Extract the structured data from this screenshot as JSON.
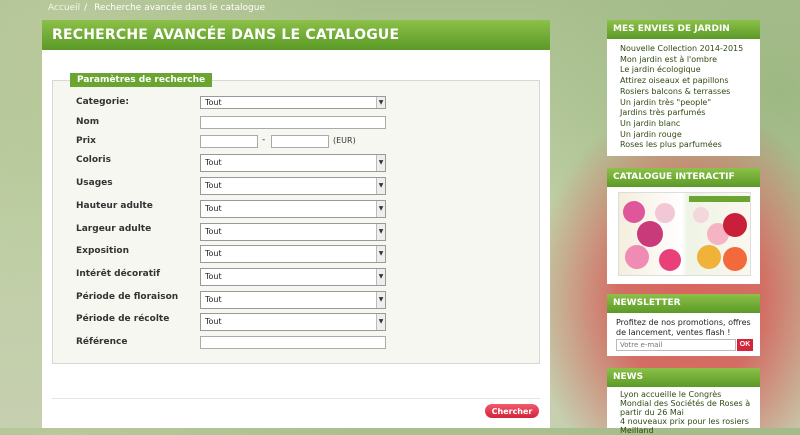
{
  "breadcrumb": {
    "home": "Accueil",
    "separator": "/",
    "current": "Recherche avancée dans le catalogue"
  },
  "main": {
    "title": "RECHERCHE AVANCÉE DANS LE CATALOGUE",
    "legend": "Paramètres de recherche",
    "fields": {
      "categorie": {
        "label": "Categorie:",
        "value": "Tout"
      },
      "nom": {
        "label": "Nom",
        "value": ""
      },
      "prix": {
        "label": "Prix",
        "from": "",
        "to": "",
        "separator": "-",
        "unit": "(EUR)"
      },
      "coloris": {
        "label": "Coloris",
        "value": "Tout"
      },
      "usages": {
        "label": "Usages",
        "value": "Tout"
      },
      "hauteur": {
        "label": "Hauteur adulte",
        "value": "Tout"
      },
      "largeur": {
        "label": "Largeur adulte",
        "value": "Tout"
      },
      "exposition": {
        "label": "Exposition",
        "value": "Tout"
      },
      "interet": {
        "label": "Intérêt décoratif",
        "value": "Tout"
      },
      "floraison": {
        "label": "Période de floraison",
        "value": "Tout"
      },
      "recolte": {
        "label": "Période de récolte",
        "value": "Tout"
      },
      "reference": {
        "label": "Référence",
        "value": ""
      }
    },
    "submit": "Chercher"
  },
  "sidebar": {
    "envies": {
      "title": "MES ENVIES DE JARDIN",
      "items": [
        "Nouvelle Collection 2014-2015",
        "Mon jardin est à l'ombre",
        "Le jardin écologique",
        "Attirez oiseaux et papillons",
        "Rosiers balcons & terrasses",
        "Un jardin très \"people\"",
        "Jardins très parfumés",
        "Un jardin blanc",
        "Un jardin rouge",
        "Roses les plus parfumées"
      ]
    },
    "catalogue": {
      "title": "CATALOGUE INTERACTIF"
    },
    "newsletter": {
      "title": "NEWSLETTER",
      "text": "Profitez de nos promotions, offres de lancement, ventes flash !",
      "placeholder": "Votre e-mail",
      "ok": "OK"
    },
    "news": {
      "title": "NEWS",
      "items": [
        "Lyon accueille le Congrès Mondial des Sociétés de Roses à partir du 26 Mai",
        "4 nouveaux prix pour les rosiers Meilland"
      ]
    }
  },
  "colors": {
    "header_green": "#6aa532",
    "button_red": "#d3243b"
  }
}
